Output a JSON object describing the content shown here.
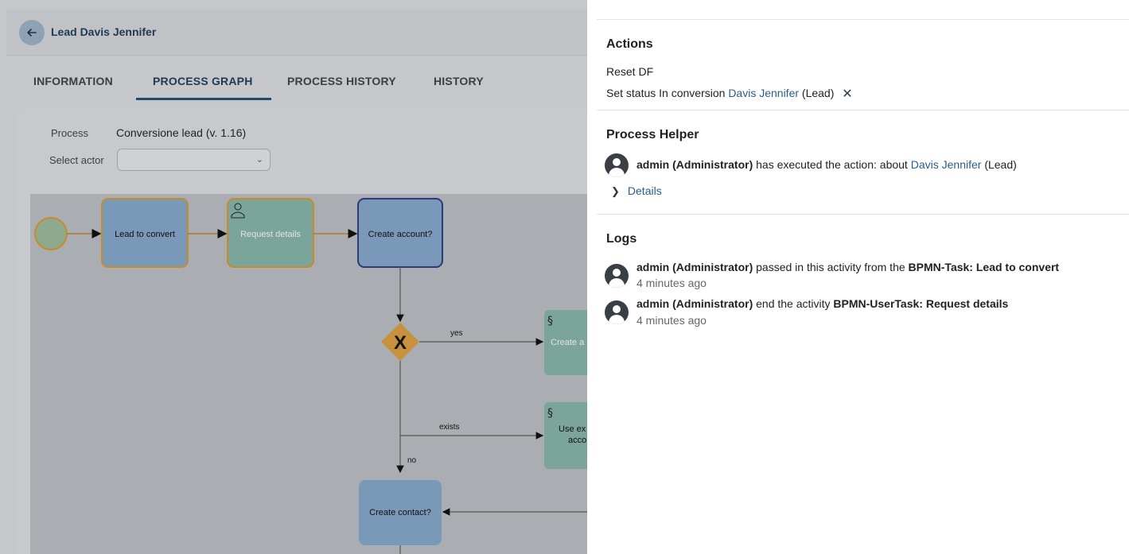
{
  "header": {
    "title": "Lead Davis Jennifer"
  },
  "tabs": [
    {
      "label": "INFORMATION"
    },
    {
      "label": "PROCESS GRAPH"
    },
    {
      "label": "PROCESS HISTORY"
    },
    {
      "label": "HISTORY"
    }
  ],
  "process": {
    "label": "Process",
    "value": "Conversione lead (v. 1.16)",
    "actor_label": "Select actor",
    "actor_value": ""
  },
  "graph": {
    "start_color": "#8fb28f",
    "nodes": {
      "lead_to_convert": "Lead to convert",
      "request_details": "Request details",
      "create_account": "Create account?",
      "create_contact": "Create contact?",
      "create_partial": "Create a",
      "use_existing_1": "Use ex",
      "use_existing_2": "acco"
    },
    "edges": {
      "yes": "yes",
      "exists": "exists",
      "no": "no"
    }
  },
  "side": {
    "actions": {
      "title": "Actions",
      "reset": "Reset DF",
      "set_status_prefix": "Set status In conversion",
      "set_status_link": "Davis Jennifer",
      "set_status_suffix": "(Lead)"
    },
    "helper": {
      "title": "Process Helper",
      "user": "admin (Administrator)",
      "text": "has executed the action: about",
      "link": "Davis Jennifer",
      "suffix": "(Lead)",
      "details": "Details"
    },
    "logs": {
      "title": "Logs",
      "entries": [
        {
          "user": "admin (Administrator)",
          "text": "passed in this activity from the",
          "target": "BPMN-Task: Lead to convert",
          "time": "4 minutes ago"
        },
        {
          "user": "admin (Administrator)",
          "text": "end the activity",
          "target": "BPMN-UserTask: Request details",
          "time": "4 minutes ago"
        }
      ]
    }
  }
}
